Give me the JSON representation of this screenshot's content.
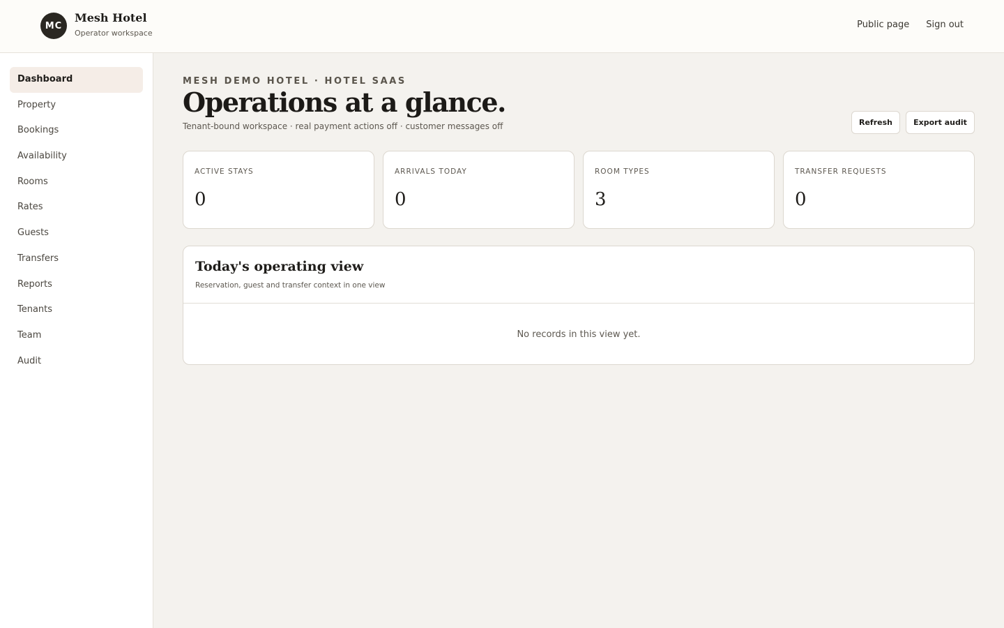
{
  "header": {
    "avatar_initials": "MC",
    "brand_name": "Mesh Hotel",
    "brand_sub": "Operator workspace",
    "nav": [
      {
        "label": "Public page"
      },
      {
        "label": "Sign out"
      }
    ]
  },
  "sidebar": {
    "items": [
      {
        "label": "Dashboard",
        "active": true
      },
      {
        "label": "Property"
      },
      {
        "label": "Bookings"
      },
      {
        "label": "Availability"
      },
      {
        "label": "Rooms"
      },
      {
        "label": "Rates"
      },
      {
        "label": "Guests"
      },
      {
        "label": "Transfers"
      },
      {
        "label": "Reports"
      },
      {
        "label": "Tenants"
      },
      {
        "label": "Team"
      },
      {
        "label": "Audit"
      }
    ]
  },
  "main": {
    "eyebrow": "MESH DEMO HOTEL · HOTEL SAAS",
    "title": "Operations at a glance.",
    "subtitle": "Tenant-bound workspace · real payment actions off · customer messages off",
    "actions": {
      "refresh_label": "Refresh",
      "export_label": "Export audit"
    },
    "stats": [
      {
        "label": "ACTIVE STAYS",
        "value": "0"
      },
      {
        "label": "ARRIVALS TODAY",
        "value": "0"
      },
      {
        "label": "ROOM TYPES",
        "value": "3"
      },
      {
        "label": "TRANSFER REQUESTS",
        "value": "0"
      }
    ],
    "panel": {
      "title": "Today's operating view",
      "subtitle": "Reservation, guest and transfer context in one view",
      "empty_text": "No records in this view yet."
    }
  },
  "colors": {
    "background": "#f4f2ee",
    "header_bg": "#fdfcf9",
    "accent_dark": "#2a2722",
    "active_nav_bg": "#f5ede7"
  }
}
